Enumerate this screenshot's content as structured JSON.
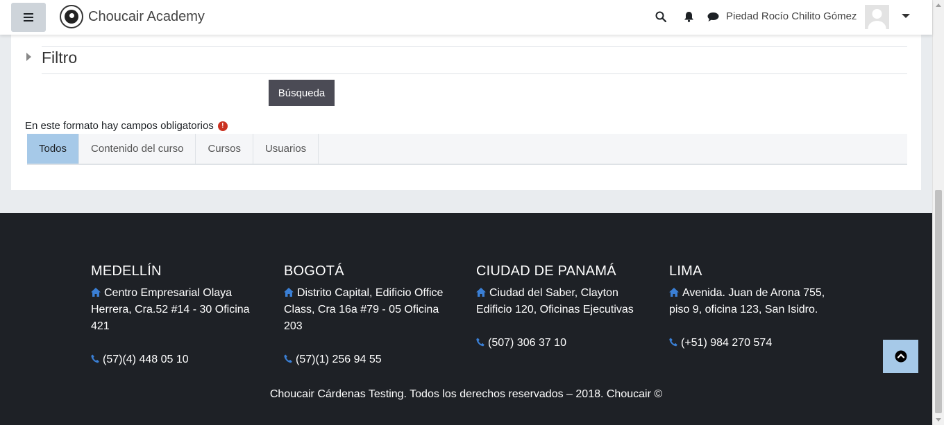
{
  "navbar": {
    "brand": "Choucair Academy",
    "user_name": "Piedad Rocío Chilito Gómez",
    "icons": [
      "hamburger-menu-icon",
      "search-icon",
      "bell-icon",
      "chat-icon",
      "chevron-down-icon"
    ]
  },
  "main": {
    "filter_title": "Filtro",
    "search_button": "Búsqueda",
    "required_note": "En este formato hay campos obligatorios",
    "tabs": [
      {
        "label": "Todos",
        "active": true
      },
      {
        "label": "Contenido del curso",
        "active": false
      },
      {
        "label": "Cursos",
        "active": false
      },
      {
        "label": "Usuarios",
        "active": false
      }
    ]
  },
  "footer": {
    "offices": [
      {
        "city": "MEDELLÍN",
        "address": "Centro Empresarial Olaya Herrera, Cra.52 #14 - 30 Oficina 421",
        "phone": "(57)(4) 448 05 10"
      },
      {
        "city": "BOGOTÁ",
        "address": "Distrito Capital, Edificio Office Class, Cra 16a #79 - 05 Oficina 203",
        "phone": "(57)(1) 256 94 55"
      },
      {
        "city": "CIUDAD DE PANAMÁ",
        "address": "Ciudad del Saber, Clayton Edificio 120, Oficinas Ejecutivas",
        "phone": "(507) 306 37 10"
      },
      {
        "city": "LIMA",
        "address": "Avenida. Juan de Arona 755, piso 9, oficina 123, San Isidro.",
        "phone": "(+51) 984 270 574"
      }
    ],
    "copyright": "Choucair Cárdenas Testing. Todos los derechos reservados – 2018. Choucair ©"
  },
  "colors": {
    "accent": "#a6c9e8",
    "footer_bg": "#1e2126",
    "icon_blue": "#3a7fd5",
    "required_red": "#ca3120",
    "search_button_bg": "#4b4b55"
  }
}
